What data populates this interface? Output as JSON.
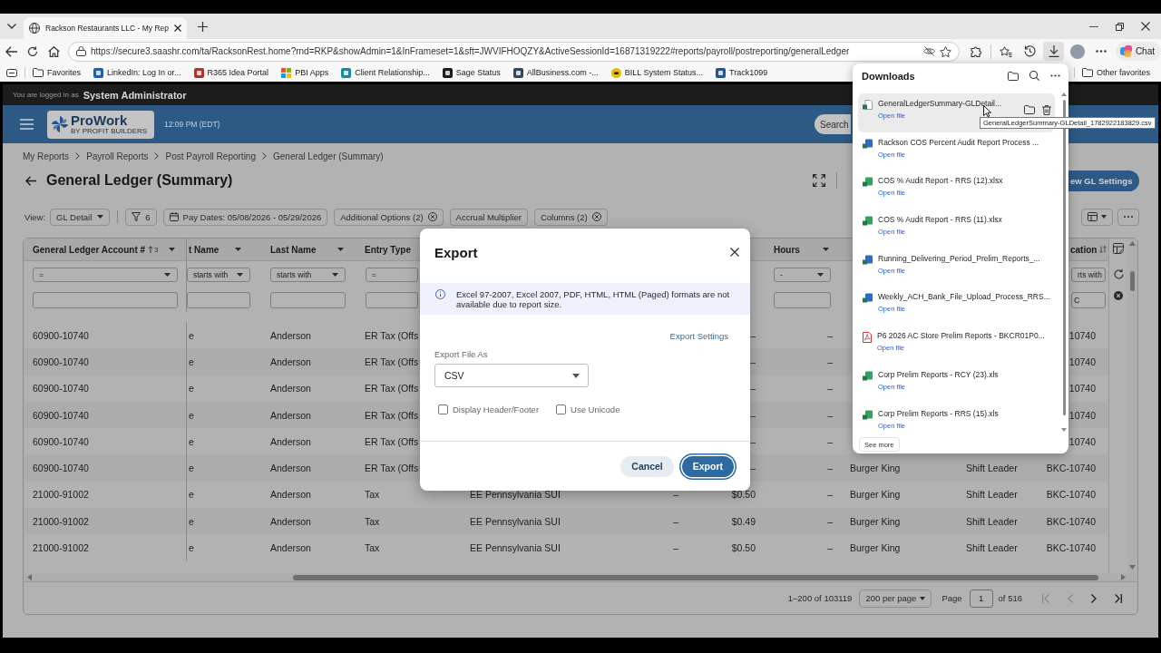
{
  "browser": {
    "tab_title": "Rackson Restaurants LLC - My Rep",
    "url": "https://secure3.saashr.com/ta/RacksonRest.home?rnd=RKP&showAdmin=1&InFrameset=1&sft=JWVIFHOQZY&ActiveSessionId=16871319222#reports/payroll/postreporting/generalLedger",
    "downloads_open": true,
    "chat_label": "Chat",
    "bookmarks": [
      {
        "label": "Favorites",
        "kind": "folder"
      },
      {
        "label": "LinkedIn: Log In or...",
        "kind": "linkedin"
      },
      {
        "label": "R365 Idea Portal",
        "kind": "r365"
      },
      {
        "label": "PBI Apps",
        "kind": "apps"
      },
      {
        "label": "Client Relationship...",
        "kind": "client"
      },
      {
        "label": "Sage Status",
        "kind": "sage"
      },
      {
        "label": "AllBusiness.com -...",
        "kind": "allbusiness"
      },
      {
        "label": "BILL System Status...",
        "kind": "bill"
      },
      {
        "label": "Track1099",
        "kind": "track"
      }
    ],
    "other_favorites": "Other favorites"
  },
  "downloads": {
    "title": "Downloads",
    "items": [
      {
        "name": "GeneralLedgerSummary-GLDetail...",
        "kind": "csv",
        "action": "Open file",
        "hovered": true
      },
      {
        "name": "Rackson COS Percent Audit Report Process ...",
        "kind": "document",
        "action": "Open file",
        "hovered": false
      },
      {
        "name": "COS % Audit Report - RRS (12).xlsx",
        "kind": "spreadsheet",
        "action": "Open file",
        "hovered": false
      },
      {
        "name": "COS % Audit Report - RRS (11).xlsx",
        "kind": "spreadsheet",
        "action": "Open file",
        "hovered": false
      },
      {
        "name": "Running_Delivering_Period_Prelim_Reports_...",
        "kind": "document",
        "action": "Open file",
        "hovered": false
      },
      {
        "name": "Weekly_ACH_Bank_File_Upload_Process_RRS...",
        "kind": "document",
        "action": "Open file",
        "hovered": false
      },
      {
        "name": "P6 2026 AC Store Prelim Reports - BKCR01P0...",
        "kind": "pdf",
        "action": "Open file",
        "hovered": false
      },
      {
        "name": "Corp Prelim Reports - RCY (23).xls",
        "kind": "spreadsheet",
        "action": "Open file",
        "hovered": false
      },
      {
        "name": "Corp Prelim Reports - RRS (15).xls",
        "kind": "spreadsheet",
        "action": "Open file",
        "hovered": false
      }
    ],
    "see_more": "See more",
    "tooltip": "GeneralLedgerSummary-GLDetail_1782922183829.csv"
  },
  "app": {
    "login_prefix": "You are logged in as",
    "user": "System Administrator",
    "logo_name": "ProWork",
    "logo_tagline": "BY PROFIT BUILDERS",
    "time": "12:09 PM (EDT)",
    "search_placeholder": "Search",
    "breadcrumbs": [
      "My Reports",
      "Payroll Reports",
      "Post Payroll Reporting",
      "General Ledger (Summary)"
    ],
    "title": "General Ledger (Summary)",
    "settings_button": "ew GL Settings",
    "view_label": "View:",
    "view": "GL Detail",
    "filter_count": "6",
    "chips": [
      {
        "label": "Pay Dates: 05/08/2026 - 05/29/2026",
        "kind": "date",
        "removable": false
      },
      {
        "label": "Additional Options (2)",
        "kind": "plain",
        "removable": true
      },
      {
        "label": "Accrual Multiplier",
        "kind": "plain",
        "removable": false
      },
      {
        "label": "Columns (2)",
        "kind": "plain",
        "removable": true
      }
    ],
    "table": {
      "columns": [
        {
          "header": "General Ledger Account #",
          "sorted": true,
          "sort_rank": "3",
          "has_menu": true,
          "filter_op": "="
        },
        {
          "header": "t Name",
          "has_menu": true,
          "filter_op": "starts with"
        },
        {
          "header": "Last Name",
          "has_menu": true,
          "filter_op": "starts with"
        },
        {
          "header": "Entry Type",
          "has_menu": false,
          "filter_op": "="
        },
        {
          "header": "Hours",
          "has_menu": true,
          "filter_op": "-"
        },
        {
          "header": "cation",
          "sorted": false,
          "has_menu": false,
          "filter_op": "rts with",
          "filter_value": "C"
        }
      ],
      "rows": [
        {
          "account_number": "60900-10740",
          "column_2": "e",
          "last_name": "Anderson",
          "entry_type": "ER Tax (Offs",
          "column_7": "–",
          "hours": "–",
          "column_11": "10740"
        },
        {
          "account_number": "60900-10740",
          "column_2": "e",
          "last_name": "Anderson",
          "entry_type": "ER Tax (Offs",
          "column_7": "–",
          "hours": "–",
          "column_11": "10740"
        },
        {
          "account_number": "60900-10740",
          "column_2": "e",
          "last_name": "Anderson",
          "entry_type": "ER Tax (Offs",
          "column_7": "–",
          "hours": "–",
          "column_11": "10740"
        },
        {
          "account_number": "60900-10740",
          "column_2": "e",
          "last_name": "Anderson",
          "entry_type": "ER Tax (Offs",
          "column_7": "–",
          "hours": "–",
          "column_11": "10740"
        },
        {
          "account_number": "60900-10740",
          "column_2": "e",
          "last_name": "Anderson",
          "entry_type": "ER Tax (Offs",
          "column_7": "–",
          "hours": "–",
          "column_11": "10740"
        },
        {
          "account_number": "60900-10740",
          "column_2": "e",
          "last_name": "Anderson",
          "entry_type": "ER Tax (Offs",
          "column_7": "–",
          "hours": "–",
          "column_9": "Burger King",
          "column_10": "Shift Leader",
          "column_11": "BKC-10740"
        },
        {
          "account_number": "21000-91002",
          "column_2": "e",
          "last_name": "Anderson",
          "entry_type": "Tax",
          "column_5": "EE Pennsylvania SUI",
          "column_6": "–",
          "column_7": "$0.50",
          "hours": "–",
          "column_9": "Burger King",
          "column_10": "Shift Leader",
          "column_11": "BKC-10740"
        },
        {
          "account_number": "21000-91002",
          "column_2": "e",
          "last_name": "Anderson",
          "entry_type": "Tax",
          "column_5": "EE Pennsylvania SUI",
          "column_6": "–",
          "column_7": "$0.49",
          "hours": "–",
          "column_9": "Burger King",
          "column_10": "Shift Leader",
          "column_11": "BKC-10740"
        },
        {
          "account_number": "21000-91002",
          "column_2": "e",
          "last_name": "Anderson",
          "entry_type": "Tax",
          "column_5": "EE Pennsylvania SUI",
          "column_6": "–",
          "column_7": "$0.50",
          "hours": "–",
          "column_9": "Burger King",
          "column_10": "Shift Leader",
          "column_11": "BKC-10740"
        }
      ]
    },
    "pagination": {
      "range": "1–200 of 103119",
      "per_page": "200 per page",
      "page_label": "Page",
      "page": "1",
      "of_pages": "of 516",
      "nav": [
        {
          "kind": "first",
          "disabled": true
        },
        {
          "kind": "previous",
          "disabled": true
        },
        {
          "kind": "next",
          "disabled": false
        },
        {
          "kind": "last",
          "disabled": false
        }
      ]
    }
  },
  "export_dialog": {
    "title": "Export",
    "notice": "Excel 97-2007, Excel 2007, PDF, HTML, HTML (Paged) formats are not available due to report size.",
    "settings_link": "Export Settings",
    "format_label": "Export File As",
    "format": "CSV",
    "options": [
      {
        "label": "Display Header/Footer",
        "checked": false
      },
      {
        "label": "Use Unicode",
        "checked": false
      }
    ],
    "buttons": [
      {
        "label": "Cancel",
        "kind": "secondary",
        "focused": false
      },
      {
        "label": "Export",
        "kind": "primary",
        "focused": true
      }
    ]
  }
}
